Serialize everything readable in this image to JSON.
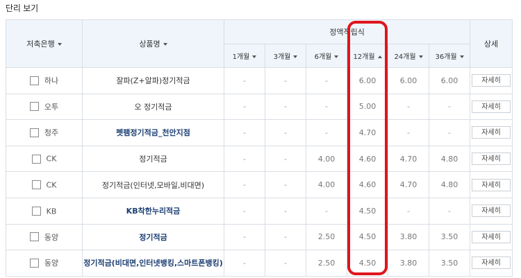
{
  "page": {
    "title": "단리 보기"
  },
  "table": {
    "headers": {
      "bank": "저축은행",
      "product": "상품명",
      "group": "정액적립식",
      "detail": "상세",
      "terms": [
        "1개월",
        "3개월",
        "6개월",
        "12개월",
        "24개월",
        "36개월"
      ]
    },
    "sort": {
      "active_term_index": 3,
      "direction": "asc"
    },
    "detail_button_label": "자세히",
    "rows": [
      {
        "bank": "하나",
        "product": "잘파(Z+알파)정기적금",
        "product_link": false,
        "rates": [
          "-",
          "-",
          "-",
          "6.00",
          "6.00",
          "6.00"
        ]
      },
      {
        "bank": "오투",
        "product": "오 정기적금",
        "product_link": false,
        "rates": [
          "-",
          "-",
          "-",
          "5.00",
          "-",
          "-"
        ]
      },
      {
        "bank": "청주",
        "product": "펫팸정기적금_천안지점",
        "product_link": true,
        "rates": [
          "-",
          "-",
          "-",
          "4.70",
          "-",
          "-"
        ]
      },
      {
        "bank": "CK",
        "product": "정기적금",
        "product_link": false,
        "rates": [
          "-",
          "-",
          "4.00",
          "4.60",
          "4.70",
          "4.80"
        ]
      },
      {
        "bank": "CK",
        "product": "정기적금(인터넷,모바일,비대면)",
        "product_link": false,
        "rates": [
          "-",
          "-",
          "4.00",
          "4.60",
          "4.70",
          "4.80"
        ]
      },
      {
        "bank": "KB",
        "product": "KB착한누리적금",
        "product_link": true,
        "rates": [
          "-",
          "-",
          "-",
          "4.50",
          "-",
          "-"
        ]
      },
      {
        "bank": "동양",
        "product": "정기적금",
        "product_link": true,
        "rates": [
          "-",
          "-",
          "2.50",
          "4.50",
          "3.80",
          "3.50"
        ]
      },
      {
        "bank": "동양",
        "product": "정기적금(비대면,인터넷뱅킹,스마트폰뱅킹)",
        "product_link": true,
        "rates": [
          "-",
          "-",
          "2.50",
          "4.50",
          "3.80",
          "3.50"
        ]
      }
    ]
  },
  "colors": {
    "header_bg": "#eff5fb",
    "highlight": "#e0141c",
    "link": "#1d3f73",
    "border": "#d8dde3"
  }
}
